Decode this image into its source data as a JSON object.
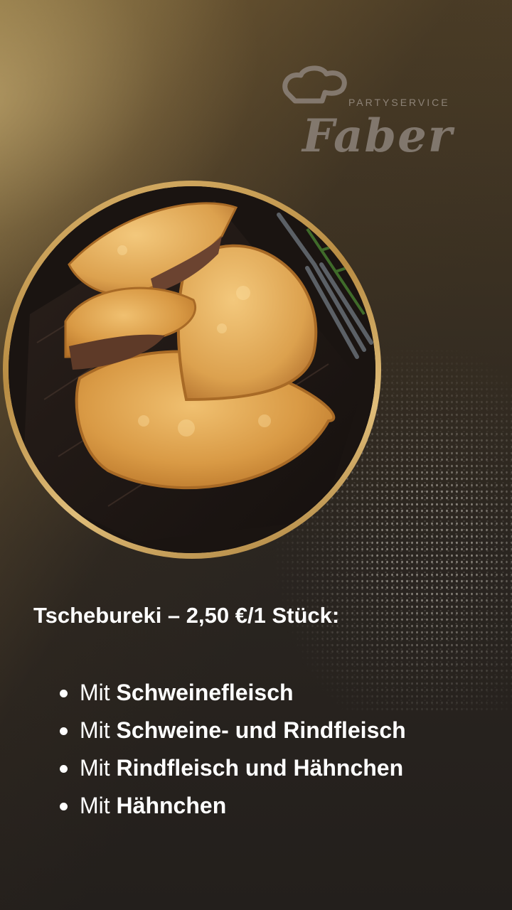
{
  "logo": {
    "subtitle": "PARTYSERVICE",
    "name": "Faber"
  },
  "image": {
    "subject": "tschebureki-photo"
  },
  "title": "Tschebureki – 2,50 €/1 Stück:",
  "items": [
    {
      "prefix": "Mit ",
      "text": "Schweinefleisch"
    },
    {
      "prefix": "Mit ",
      "text": "Schweine- und Rindfleisch"
    },
    {
      "prefix": "Mit ",
      "text": "Rindfleisch und Hähnchen"
    },
    {
      "prefix": "Mit ",
      "text": "Hähnchen"
    }
  ],
  "colors": {
    "accent_gold": "#c9a25a",
    "text": "#ffffff",
    "background_dark": "#231f1c"
  }
}
